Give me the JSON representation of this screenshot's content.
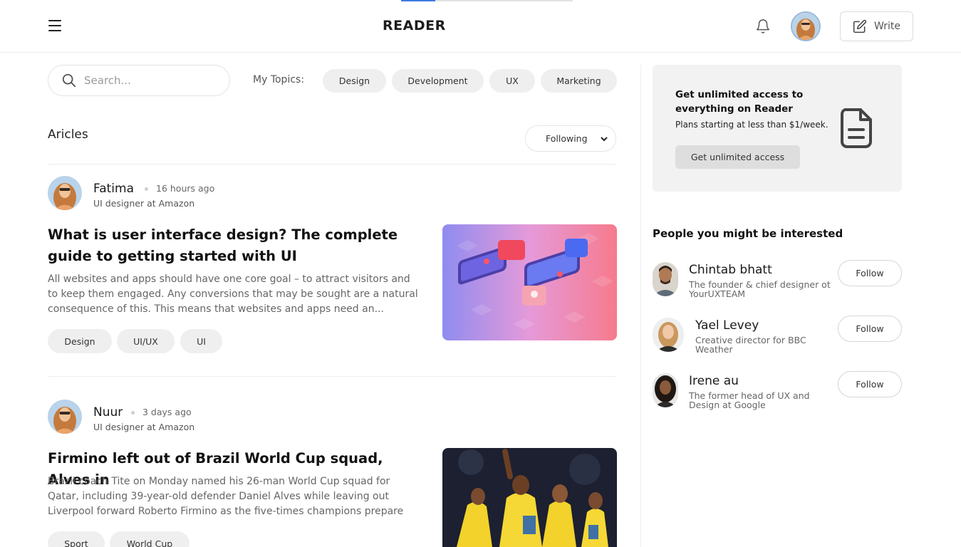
{
  "header": {
    "brand": "READER",
    "write_label": "Write",
    "icons": {
      "menu": "hamburger-menu-icon",
      "bell": "bell-icon",
      "write": "edit-icon"
    }
  },
  "search": {
    "placeholder": "Search..."
  },
  "topics": {
    "label": "My Topics:",
    "items": [
      "Design",
      "Development",
      "UX",
      "Marketing"
    ]
  },
  "articles_section": {
    "title": "Aricles",
    "sort_value": "Following"
  },
  "articles": [
    {
      "author": "Fatima",
      "time": "16 hours ago",
      "role": "UI designer at Amazon",
      "title": "What is user interface design? The complete guide to getting started with UI",
      "excerpt": "All websites and apps should have one core goal – to attract visitors and to keep them engaged. Any conversions that may be sought are a natural consequence of this. This means that websites and apps need an...",
      "tags": [
        "Design",
        "UI/UX",
        "UI"
      ]
    },
    {
      "author": "Nuur",
      "time": "3 days ago",
      "role": "UI designer at Amazon",
      "title": "Firmino left out of Brazil World Cup squad, Alves in",
      "excerpt": "Brazil coach Tite on Monday named his 26-man World Cup squad for Qatar, including 39-year-old defender Daniel Alves while leaving out Liverpool forward Roberto Firmino as the five-times champions prepare fo...",
      "tags": [
        "Sport",
        "World Cup"
      ]
    }
  ],
  "promo": {
    "title": "Get unlimited access to everything on Reader",
    "subtitle": "Plans starting at less than $1/week.",
    "button": "Get unlimited access"
  },
  "people": {
    "title": "People you might be interested",
    "follow_label": "Follow",
    "items": [
      {
        "name": "Chintab bhatt",
        "bio": "The founder & chief designer ot YourUXTEAM"
      },
      {
        "name": "Yael Levey",
        "bio": "Creative director for BBC Weather"
      },
      {
        "name": "Irene au",
        "bio": "The former head of UX and Design at Google"
      }
    ]
  },
  "colors": {
    "accent_strip": "#3d7be0",
    "chip_bg": "#efefef",
    "promo_bg": "#f2f2f2"
  }
}
